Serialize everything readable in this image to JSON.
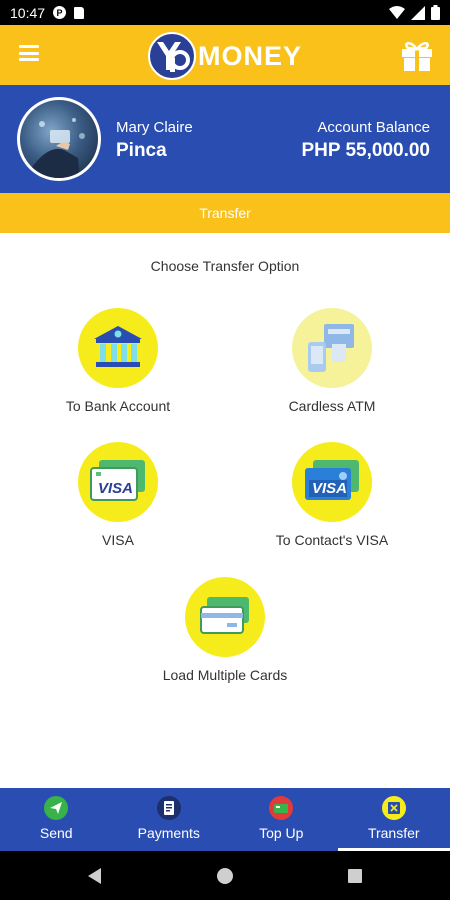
{
  "status_bar": {
    "time": "10:47",
    "icons": [
      "notification-p-icon",
      "sd-card-icon",
      "wifi-icon",
      "signal-icon",
      "battery-icon"
    ]
  },
  "app_bar": {
    "logo_text": "MONEY",
    "icons": [
      "menu-icon",
      "logo-icon",
      "gift-icon"
    ]
  },
  "profile": {
    "first_name": "Mary Claire",
    "last_name": "Pinca",
    "balance_label": "Account Balance",
    "balance_value": "PHP 55,000.00"
  },
  "section_title": "Transfer",
  "choose_title": "Choose Transfer Option",
  "options": [
    {
      "label": "To Bank Account",
      "icon": "bank-icon"
    },
    {
      "label": "Cardless ATM",
      "icon": "cardless-atm-icon"
    },
    {
      "label": "VISA",
      "icon": "visa-card-icon",
      "card_text": "VISA"
    },
    {
      "label": "To Contact's VISA",
      "icon": "contact-visa-icon",
      "card_text": "VISA"
    },
    {
      "label": "Load Multiple Cards",
      "icon": "multiple-cards-icon"
    }
  ],
  "bottom_nav": [
    {
      "label": "Send",
      "icon": "send-icon"
    },
    {
      "label": "Payments",
      "icon": "payments-icon"
    },
    {
      "label": "Top Up",
      "icon": "top-up-icon"
    },
    {
      "label": "Transfer",
      "icon": "transfer-icon",
      "active": true
    }
  ],
  "colors": {
    "brand_yellow": "#f9c11a",
    "brand_blue": "#2a4db1",
    "option_yellow": "#f7ec1b"
  }
}
